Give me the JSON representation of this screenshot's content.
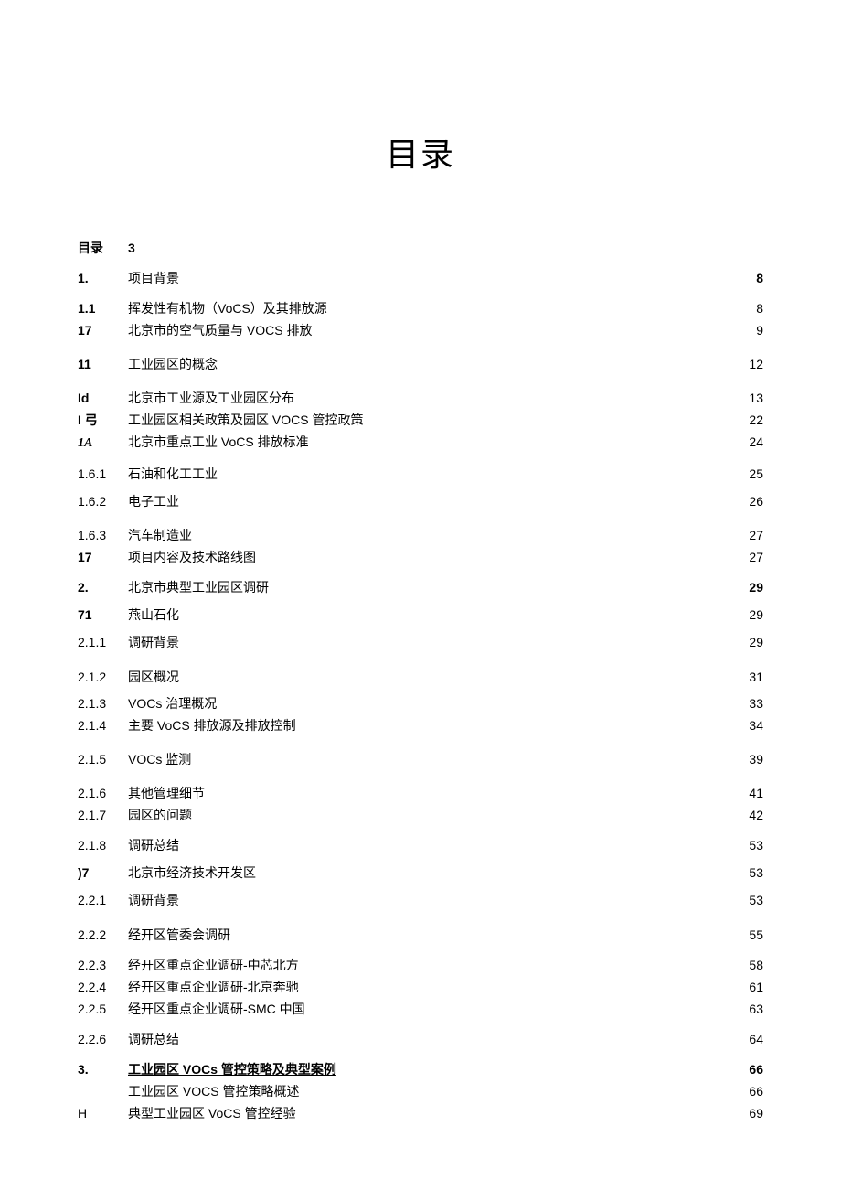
{
  "title": "目录",
  "rows": [
    {
      "num": "目录",
      "numClass": "bold",
      "txt": "3",
      "txtClass": "bold arial",
      "pg": "",
      "rowClass": "lh18"
    },
    {
      "num": "1.",
      "numClass": "bold arial",
      "txt": "项目背景",
      "txtClass": "",
      "pg": "8",
      "pgClass": "bold",
      "rowClass": "mt14 lh20"
    },
    {
      "num": "1.1",
      "numClass": "bold arial",
      "txt": "挥发性有机物（VoCS）及其排放源",
      "txtClass": "",
      "pg": "8",
      "rowClass": "mt14 lh18"
    },
    {
      "num": "17",
      "numClass": "bold arial",
      "txt": "北京市的空气质量与 VOCS 排放",
      "txtClass": "",
      "pg": "9",
      "rowClass": "mt6 lh18"
    },
    {
      "num": "11",
      "numClass": "bold arial",
      "txt": "工业园区的概念",
      "txtClass": "",
      "pg": "12",
      "rowClass": "mt18 lh20"
    },
    {
      "num": "Id",
      "numClass": "bold arial",
      "txt": "北京市工业源及工业园区分布",
      "txtClass": "",
      "pg": "13",
      "rowClass": "mt18 lh18"
    },
    {
      "num": "I 弓",
      "numClass": "bold",
      "txt": "工业园区相关政策及园区 VOCS 管控政策",
      "txtClass": "",
      "pg": "22",
      "rowClass": "mt6 lh18"
    },
    {
      "num": "1A",
      "numClass": "bold italic",
      "txt": "北京市重点工业 VoCS 排放标准",
      "txtClass": "",
      "pg": "24",
      "rowClass": "mt6 lh18"
    },
    {
      "num": "1.6.1",
      "numClass": "arial",
      "txt": "石油和化工工业",
      "txtClass": "",
      "pg": "25",
      "rowClass": "mt14 lh20"
    },
    {
      "num": "1.6.2",
      "numClass": "arial",
      "txt": "电子工业",
      "txtClass": "",
      "pg": "26",
      "rowClass": "mt10 lh20"
    },
    {
      "num": "1.6.3",
      "numClass": "arial",
      "txt": "汽车制造业",
      "txtClass": "",
      "pg": "27",
      "rowClass": "mt18 lh18"
    },
    {
      "num": "17",
      "numClass": "bold arial",
      "txt": "项目内容及技术路线图",
      "txtClass": "",
      "pg": "27",
      "rowClass": "mt6 lh18"
    },
    {
      "num": "2.",
      "numClass": "bold arial",
      "txt": "北京市典型工业园区调研",
      "txtClass": "",
      "pg": "29",
      "pgClass": "bold",
      "rowClass": "mt14 lh20"
    },
    {
      "num": "71",
      "numClass": "bold arial",
      "txt": "燕山石化",
      "txtClass": "",
      "pg": "29",
      "rowClass": "mt10 lh20"
    },
    {
      "num": "2.1.1",
      "numClass": "arial",
      "txt": "调研背景",
      "txtClass": "",
      "pg": "29",
      "rowClass": "mt10 lh20"
    },
    {
      "num": "2.1.2",
      "numClass": "arial",
      "txt": "园区概况",
      "txtClass": "",
      "pg": "31",
      "rowClass": "mt18 lh20"
    },
    {
      "num": "2.1.3",
      "numClass": "arial",
      "txt": "VOCs 治理概况",
      "txtClass": "",
      "pg": "33",
      "rowClass": "mt10 lh18"
    },
    {
      "num": "2.1.4",
      "numClass": "arial",
      "txt": "主要 VoCS 排放源及排放控制",
      "txtClass": "",
      "pg": "34",
      "rowClass": "mt6 lh18"
    },
    {
      "num": "2.1.5",
      "numClass": "arial",
      "txt": "VOCs 监测",
      "txtClass": "",
      "pg": "39",
      "rowClass": "mt18 lh20"
    },
    {
      "num": "2.1.6",
      "numClass": "arial",
      "txt": "其他管理细节",
      "txtClass": "",
      "pg": "41",
      "rowClass": "mt18 lh18"
    },
    {
      "num": "2.1.7",
      "numClass": "arial",
      "txt": "园区的问题",
      "txtClass": "",
      "pg": "42",
      "rowClass": "mt6 lh18"
    },
    {
      "num": "2.1.8",
      "numClass": "arial",
      "txt": "调研总结",
      "txtClass": "",
      "pg": "53",
      "rowClass": "mt14 lh20"
    },
    {
      "num": ")7",
      "numClass": "bold arial",
      "txt": "北京市经济技术开发区",
      "txtClass": "",
      "pg": "53",
      "rowClass": "mt10 lh20"
    },
    {
      "num": "2.2.1",
      "numClass": "arial",
      "txt": "调研背景",
      "txtClass": "",
      "pg": "53",
      "rowClass": "mt10 lh20"
    },
    {
      "num": "2.2.2",
      "numClass": "arial",
      "txt": "经开区管委会调研",
      "txtClass": "",
      "pg": "55",
      "rowClass": "mt18 lh20"
    },
    {
      "num": "2.2.3",
      "numClass": "arial",
      "txt": "经开区重点企业调研-中芯北方",
      "txtClass": "",
      "pg": "58",
      "rowClass": "mt14 lh18"
    },
    {
      "num": "2.2.4",
      "numClass": "arial",
      "txt": "经开区重点企业调研-北京奔驰",
      "txtClass": "",
      "pg": "61",
      "rowClass": "mt6 lh18"
    },
    {
      "num": "2.2.5",
      "numClass": "arial",
      "txt": "经开区重点企业调研-SMC 中国",
      "txtClass": "",
      "pg": "63",
      "rowClass": "mt6 lh18"
    },
    {
      "num": "2.2.6",
      "numClass": "arial",
      "txt": "调研总结",
      "txtClass": "",
      "pg": "64",
      "rowClass": "mt14 lh20"
    },
    {
      "num": "3.",
      "numClass": "bold arial",
      "txt": "工业园区 VOCs 管控策略及典型案例",
      "txtClass": "bold under",
      "pg": "66",
      "pgClass": "bold",
      "rowClass": "mt14 lh18"
    },
    {
      "num": "",
      "numClass": "",
      "txt": "工业园区 VOCS 管控策略概述",
      "txtClass": "",
      "pg": "66",
      "rowClass": "mt6 lh18"
    },
    {
      "num": "H",
      "numClass": "arial",
      "txt": "典型工业园区 VoCS 管控经验",
      "txtClass": "",
      "pg": "69",
      "rowClass": "mt6 lh18"
    }
  ]
}
